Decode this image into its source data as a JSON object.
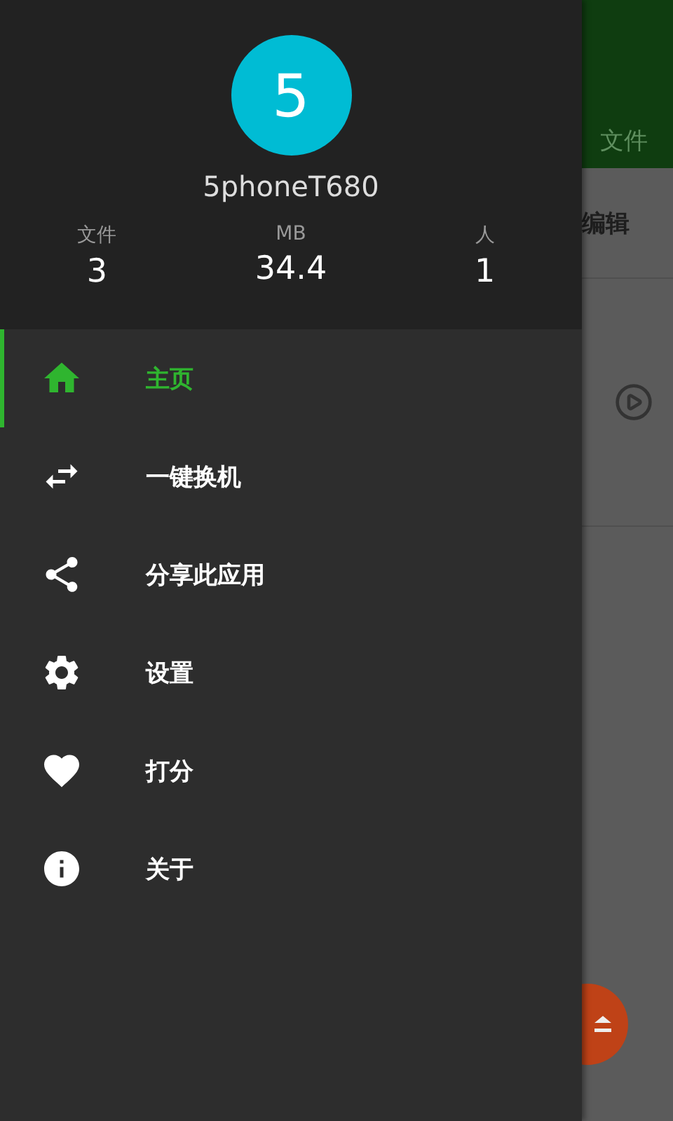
{
  "drawer": {
    "avatar": "5",
    "device_name": "5phoneT680",
    "stats": [
      {
        "label": "文件",
        "value": "3"
      },
      {
        "label": "MB",
        "value": "34.4"
      },
      {
        "label": "人",
        "value": "1"
      }
    ],
    "items": [
      {
        "kind": "home",
        "label": "主页",
        "selected": true
      },
      {
        "kind": "swap",
        "label": "一键换机",
        "selected": false
      },
      {
        "kind": "share",
        "label": "分享此应用",
        "selected": false
      },
      {
        "kind": "settings",
        "label": "设置",
        "selected": false
      },
      {
        "kind": "rate",
        "label": "打分",
        "selected": false
      },
      {
        "kind": "about",
        "label": "关于",
        "selected": false
      }
    ]
  },
  "background": {
    "tab": "文件",
    "action": "编辑"
  }
}
